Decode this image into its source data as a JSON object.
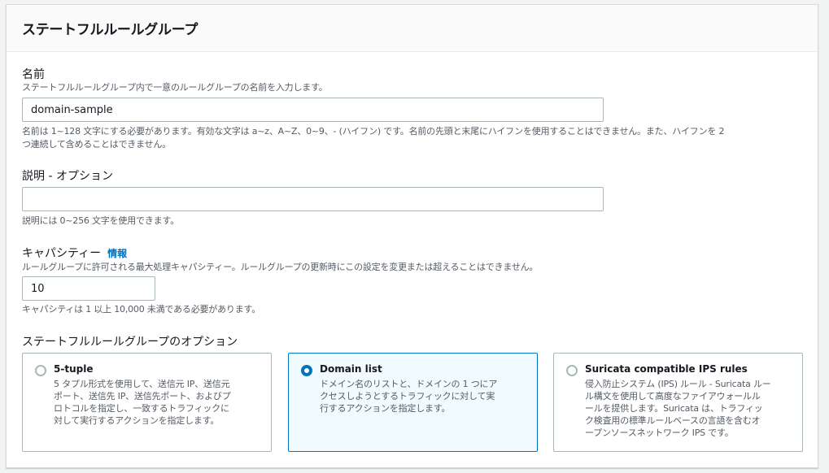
{
  "panel": {
    "title": "ステートフルルールグループ"
  },
  "name_field": {
    "label": "名前",
    "description": "ステートフルルールグループ内で一意のルールグループの名前を入力します。",
    "value": "domain-sample",
    "hint_line1": "名前は 1~128 文字にする必要があります。有効な文字は a~z、A~Z、0~9、- (ハイフン) です。名前の先頭と末尾にハイフンを使用することはできません。また、ハイフンを 2",
    "hint_line2": "つ連続して含めることはできません。"
  },
  "description_field": {
    "label": "説明 - オプション",
    "value": "",
    "hint": "説明には 0~256 文字を使用できます。"
  },
  "capacity_field": {
    "label": "キャパシティー",
    "info_link": "情報",
    "description": "ルールグループに許可される最大処理キャパシティー。ルールグループの更新時にこの設定を変更または超えることはできません。",
    "value": "10",
    "hint": "キャパシティは 1 以上 10,000 未満である必要があります。"
  },
  "options": {
    "label": "ステートフルルールグループのオプション",
    "selected": "domain-list",
    "tiles": [
      {
        "title": "5-tuple",
        "desc": [
          "5 タプル形式を使用して、送信元 IP、送信元",
          "ポート、送信先 IP、送信先ポート、およびプ",
          "ロトコルを指定し、一致するトラフィックに",
          "対して実行するアクションを指定します。"
        ]
      },
      {
        "title": "Domain list",
        "desc": [
          "ドメイン名のリストと、ドメインの 1 つにア",
          "クセスしようとするトラフィックに対して実",
          "行するアクションを指定します。"
        ]
      },
      {
        "title": "Suricata compatible IPS rules",
        "desc": [
          "侵入防止システム (IPS) ルール - Suricata ルー",
          "ル構文を使用して高度なファイアウォールル",
          "ールを提供します。Suricata は、トラフィッ",
          "ク検査用の標準ルールベースの言語を含むオ",
          "ープンソースネットワーク IPS です。"
        ]
      }
    ]
  }
}
